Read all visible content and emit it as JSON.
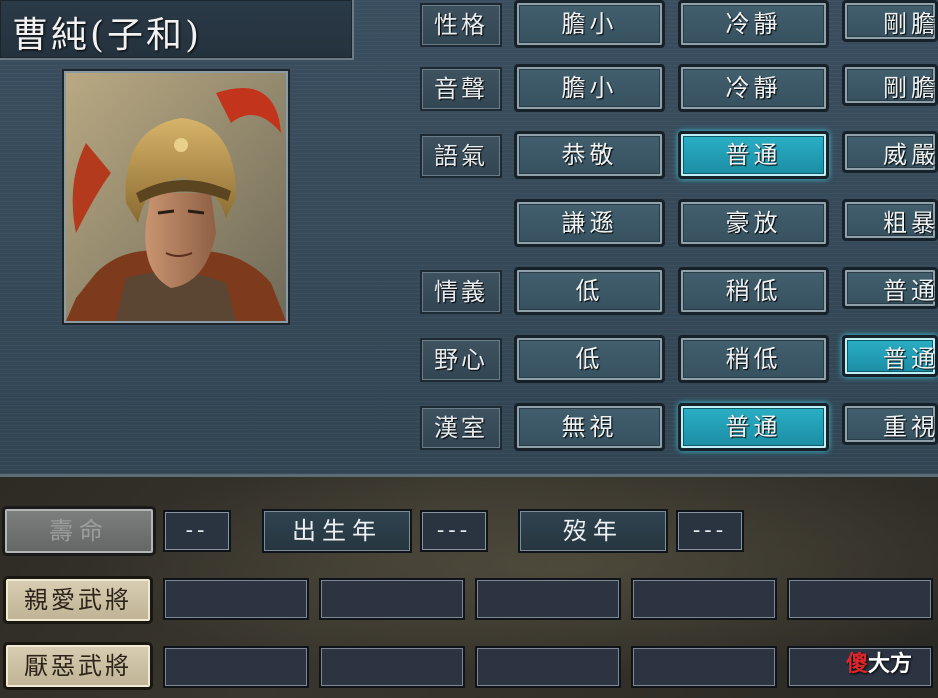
{
  "officer": {
    "name": "曹純(子和)"
  },
  "traits": [
    {
      "label": "性格",
      "options": [
        "膽小",
        "冷靜",
        "剛膽"
      ],
      "selected": -1
    },
    {
      "label": "音聲",
      "options": [
        "膽小",
        "冷靜",
        "剛膽"
      ],
      "selected": -1
    },
    {
      "label": "語氣",
      "options": [
        "恭敬",
        "普通",
        "威嚴"
      ],
      "selected": 1
    },
    {
      "label": "",
      "options": [
        "謙遜",
        "豪放",
        "粗暴"
      ],
      "selected": -1
    },
    {
      "label": "情義",
      "options": [
        "低",
        "稍低",
        "普通"
      ],
      "selected": -1
    },
    {
      "label": "野心",
      "options": [
        "低",
        "稍低",
        "普通"
      ],
      "selected": 2
    },
    {
      "label": "漢室",
      "options": [
        "無視",
        "普通",
        "重視"
      ],
      "selected": 1
    }
  ],
  "lifespan": {
    "button_label": "壽命",
    "lifespan_value": "--",
    "birth_label": "出生年",
    "birth_value": "---",
    "death_label": "歿年",
    "death_value": "---"
  },
  "relations": {
    "liked_label": "親愛武將",
    "disliked_label": "厭惡武將"
  },
  "watermark": {
    "red": "傻",
    "white": "大方"
  },
  "colors": {
    "selected_option": "#1f9db4",
    "option": "#3c5866",
    "panel": "#364a59"
  }
}
